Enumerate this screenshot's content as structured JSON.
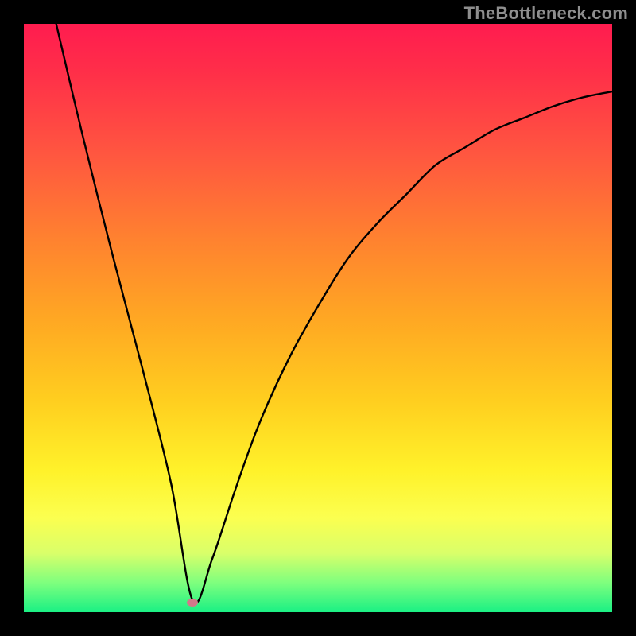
{
  "watermark": "TheBottleneck.com",
  "colors": {
    "page_bg": "#000000",
    "curve_stroke": "#000000",
    "marker_fill": "#d3788a",
    "watermark_text": "#8e8e8e"
  },
  "chart_data": {
    "type": "line",
    "title": "",
    "xlabel": "",
    "ylabel": "",
    "xlim": [
      0,
      1
    ],
    "ylim": [
      0,
      1
    ],
    "grid": false,
    "legend": false,
    "series": [
      {
        "name": "curve",
        "x": [
          0.055,
          0.1,
          0.15,
          0.2,
          0.25,
          0.287,
          0.32,
          0.36,
          0.4,
          0.45,
          0.5,
          0.55,
          0.6,
          0.65,
          0.7,
          0.75,
          0.8,
          0.85,
          0.9,
          0.95,
          1.0
        ],
        "y": [
          1.0,
          0.81,
          0.61,
          0.42,
          0.22,
          0.02,
          0.09,
          0.21,
          0.32,
          0.43,
          0.52,
          0.6,
          0.66,
          0.71,
          0.76,
          0.79,
          0.82,
          0.84,
          0.86,
          0.875,
          0.885
        ]
      }
    ],
    "marker": {
      "x": 0.287,
      "y": 0.016
    }
  }
}
